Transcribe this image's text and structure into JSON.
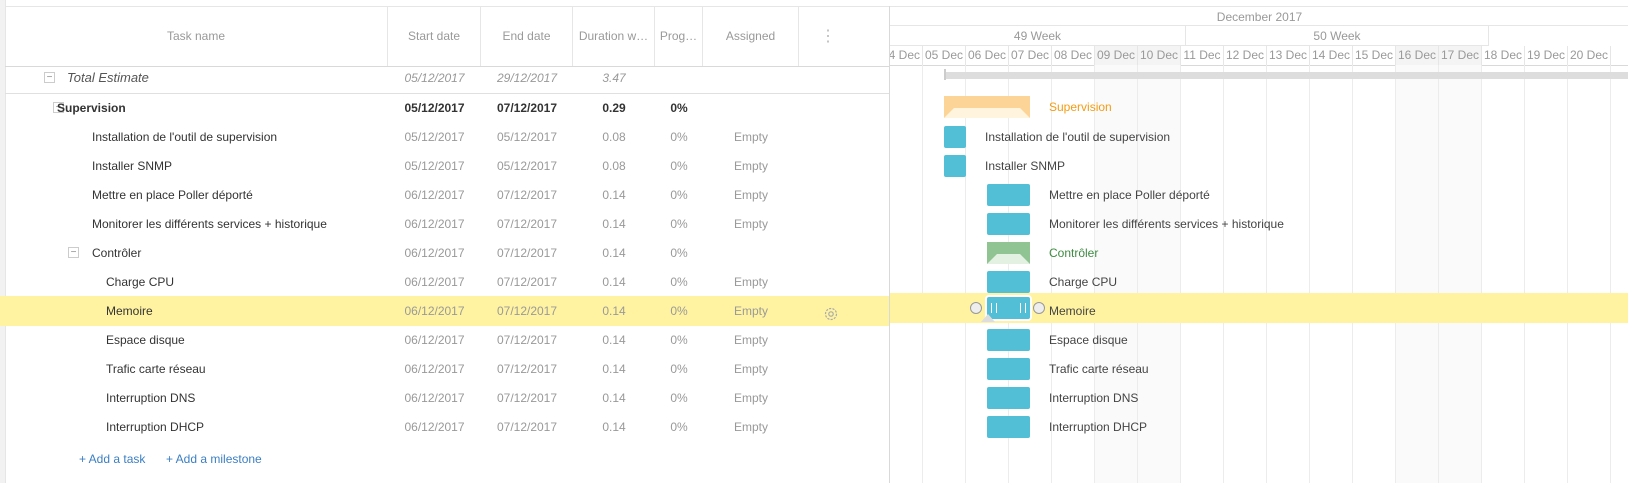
{
  "grid": {
    "columns": {
      "task_name": "Task name",
      "start_date": "Start date",
      "end_date": "End date",
      "duration": "Duration w…",
      "progress": "Prog…",
      "assigned": "Assigned",
      "menu": "⋮"
    },
    "total": {
      "name": "Total Estimate",
      "start": "05/12/2017",
      "end": "29/12/2017",
      "duration": "3.47",
      "progress": "",
      "assigned": ""
    },
    "rows": [
      {
        "name": "Supervision",
        "start": "05/12/2017",
        "end": "07/12/2017",
        "duration": "0.29",
        "progress": "0%",
        "assigned": ""
      },
      {
        "name": "Installation de l'outil de supervision",
        "start": "05/12/2017",
        "end": "05/12/2017",
        "duration": "0.08",
        "progress": "0%",
        "assigned": "Empty"
      },
      {
        "name": "Installer SNMP",
        "start": "05/12/2017",
        "end": "05/12/2017",
        "duration": "0.08",
        "progress": "0%",
        "assigned": "Empty"
      },
      {
        "name": "Mettre en place Poller déporté",
        "start": "06/12/2017",
        "end": "07/12/2017",
        "duration": "0.14",
        "progress": "0%",
        "assigned": "Empty"
      },
      {
        "name": "Monitorer les différents services + historique",
        "start": "06/12/2017",
        "end": "07/12/2017",
        "duration": "0.14",
        "progress": "0%",
        "assigned": "Empty"
      },
      {
        "name": "Contrôler",
        "start": "06/12/2017",
        "end": "07/12/2017",
        "duration": "0.14",
        "progress": "0%",
        "assigned": ""
      },
      {
        "name": "Charge CPU",
        "start": "06/12/2017",
        "end": "07/12/2017",
        "duration": "0.14",
        "progress": "0%",
        "assigned": "Empty"
      },
      {
        "name": "Memoire",
        "start": "06/12/2017",
        "end": "07/12/2017",
        "duration": "0.14",
        "progress": "0%",
        "assigned": "Empty"
      },
      {
        "name": "Espace disque",
        "start": "06/12/2017",
        "end": "07/12/2017",
        "duration": "0.14",
        "progress": "0%",
        "assigned": "Empty"
      },
      {
        "name": "Trafic carte réseau",
        "start": "06/12/2017",
        "end": "07/12/2017",
        "duration": "0.14",
        "progress": "0%",
        "assigned": "Empty"
      },
      {
        "name": "Interruption DNS",
        "start": "06/12/2017",
        "end": "07/12/2017",
        "duration": "0.14",
        "progress": "0%",
        "assigned": "Empty"
      },
      {
        "name": "Interruption DHCP",
        "start": "06/12/2017",
        "end": "07/12/2017",
        "duration": "0.14",
        "progress": "0%",
        "assigned": "Empty"
      }
    ],
    "add_task": "+ Add a task",
    "add_milestone": "+ Add a milestone"
  },
  "timeline": {
    "month": "December 2017",
    "weeks": [
      "49 Week",
      "50 Week"
    ],
    "days": [
      "04 Dec",
      "05 Dec",
      "06 Dec",
      "07 Dec",
      "08 Dec",
      "09 Dec",
      "10 Dec",
      "11 Dec",
      "12 Dec",
      "13 Dec",
      "14 Dec",
      "15 Dec",
      "16 Dec",
      "17 Dec",
      "18 Dec",
      "19 Dec",
      "20 Dec"
    ],
    "bar_labels": {
      "supervision": "Supervision",
      "install": "Installation de l'outil de supervision",
      "snmp": "Installer SNMP",
      "poller": "Mettre en place Poller déporté",
      "monitor": "Monitorer les différents services + historique",
      "controler": "Contrôler",
      "cpu": "Charge CPU",
      "memoire": "Memoire",
      "disque": "Espace disque",
      "reseau": "Trafic carte réseau",
      "dns": "Interruption DNS",
      "dhcp": "Interruption DHCP"
    }
  },
  "colors": {
    "task_bar": "#52bfd6",
    "project_orange": "#fdd497",
    "project_green": "#90c493",
    "selected_row": "#fff3a1",
    "link": "#3b7fc4"
  }
}
